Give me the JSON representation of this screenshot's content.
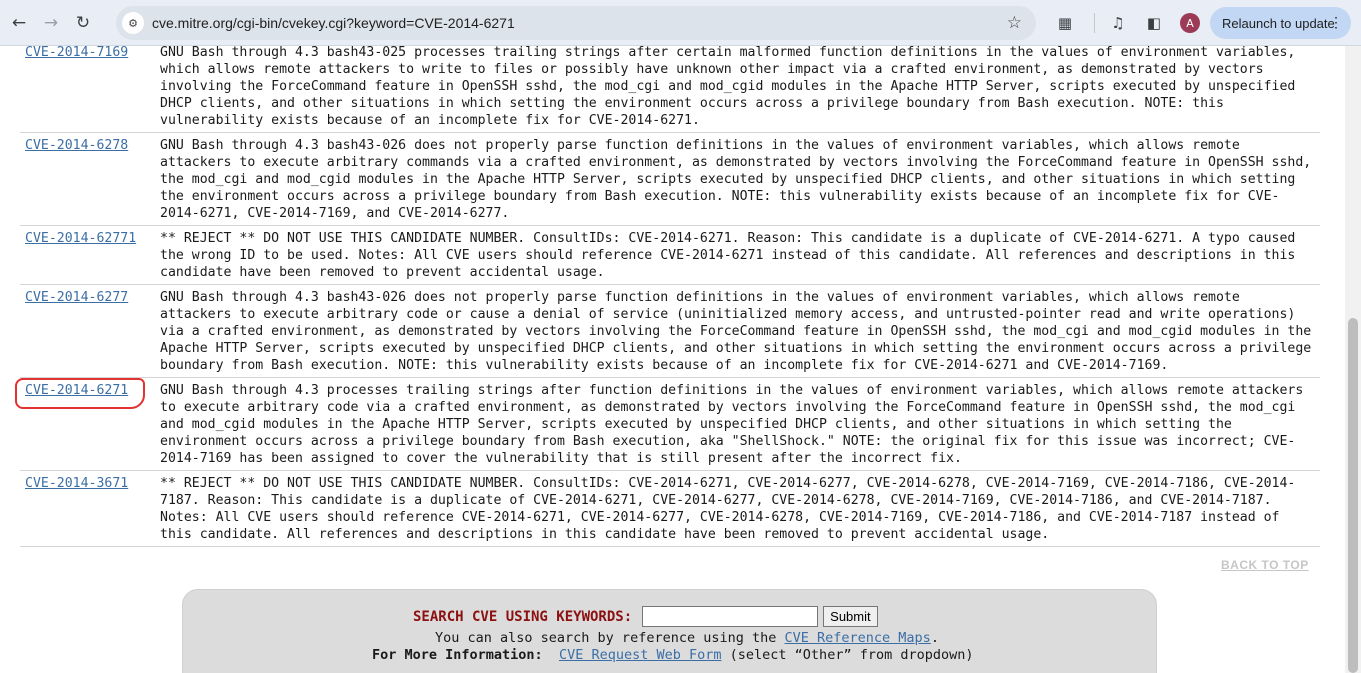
{
  "browser": {
    "url": "cve.mitre.org/cgi-bin/cvekey.cgi?keyword=CVE-2014-6271",
    "relaunch_label": "Relaunch to update",
    "avatar_initial": "A"
  },
  "rows": [
    {
      "id": "CVE-2014-7169",
      "description": "GNU Bash through 4.3 bash43-025 processes trailing strings after certain malformed function definitions in the values of environment variables, which allows remote attackers to write to files or possibly have unknown other impact via a crafted environment, as demonstrated by vectors involving the ForceCommand feature in OpenSSH sshd, the mod_cgi and mod_cgid modules in the Apache HTTP Server, scripts executed by unspecified DHCP clients, and other situations in which setting the environment occurs across a privilege boundary from Bash execution. NOTE: this vulnerability exists because of an incomplete fix for CVE-2014-6271."
    },
    {
      "id": "CVE-2014-6278",
      "description": "GNU Bash through 4.3 bash43-026 does not properly parse function definitions in the values of environment variables, which allows remote attackers to execute arbitrary commands via a crafted environment, as demonstrated by vectors involving the ForceCommand feature in OpenSSH sshd, the mod_cgi and mod_cgid modules in the Apache HTTP Server, scripts executed by unspecified DHCP clients, and other situations in which setting the environment occurs across a privilege boundary from Bash execution. NOTE: this vulnerability exists because of an incomplete fix for CVE-2014-6271, CVE-2014-7169, and CVE-2014-6277."
    },
    {
      "id": "CVE-2014-62771",
      "description": "** REJECT ** DO NOT USE THIS CANDIDATE NUMBER. ConsultIDs: CVE-2014-6271. Reason: This candidate is a duplicate of CVE-2014-6271. A typo caused the wrong ID to be used. Notes: All CVE users should reference CVE-2014-6271 instead of this candidate. All references and descriptions in this candidate have been removed to prevent accidental usage."
    },
    {
      "id": "CVE-2014-6277",
      "description": "GNU Bash through 4.3 bash43-026 does not properly parse function definitions in the values of environment variables, which allows remote attackers to execute arbitrary code or cause a denial of service (uninitialized memory access, and untrusted-pointer read and write operations) via a crafted environment, as demonstrated by vectors involving the ForceCommand feature in OpenSSH sshd, the mod_cgi and mod_cgid modules in the Apache HTTP Server, scripts executed by unspecified DHCP clients, and other situations in which setting the environment occurs across a privilege boundary from Bash execution. NOTE: this vulnerability exists because of an incomplete fix for CVE-2014-6271 and CVE-2014-7169."
    },
    {
      "id": "CVE-2014-6271",
      "description": "GNU Bash through 4.3 processes trailing strings after function definitions in the values of environment variables, which allows remote attackers to execute arbitrary code via a crafted environment, as demonstrated by vectors involving the ForceCommand feature in OpenSSH sshd, the mod_cgi and mod_cgid modules in the Apache HTTP Server, scripts executed by unspecified DHCP clients, and other situations in which setting the environment occurs across a privilege boundary from Bash execution, aka \"ShellShock.\" NOTE: the original fix for this issue was incorrect; CVE-2014-7169 has been assigned to cover the vulnerability that is still present after the incorrect fix."
    },
    {
      "id": "CVE-2014-3671",
      "description": "** REJECT ** DO NOT USE THIS CANDIDATE NUMBER. ConsultIDs: CVE-2014-6271, CVE-2014-6277, CVE-2014-6278, CVE-2014-7169, CVE-2014-7186, CVE-2014-7187. Reason: This candidate is a duplicate of CVE-2014-6271, CVE-2014-6277, CVE-2014-6278, CVE-2014-7169, CVE-2014-7186, and CVE-2014-7187. Notes: All CVE users should reference CVE-2014-6271, CVE-2014-6277, CVE-2014-6278, CVE-2014-7169, CVE-2014-7186, and CVE-2014-7187 instead of this candidate. All references and descriptions in this candidate have been removed to prevent accidental usage."
    }
  ],
  "back_to_top": "BACK TO TOP",
  "search": {
    "label": "SEARCH CVE USING KEYWORDS:",
    "input_value": "",
    "submit_label": "Submit",
    "ref_prefix": "You can also search by reference using the",
    "ref_link": "CVE Reference Maps",
    "ref_suffix": ".",
    "more_info_label": "For More Information:",
    "request_link": "CVE Request Web Form",
    "request_suffix": "(select “Other” from dropdown)"
  }
}
